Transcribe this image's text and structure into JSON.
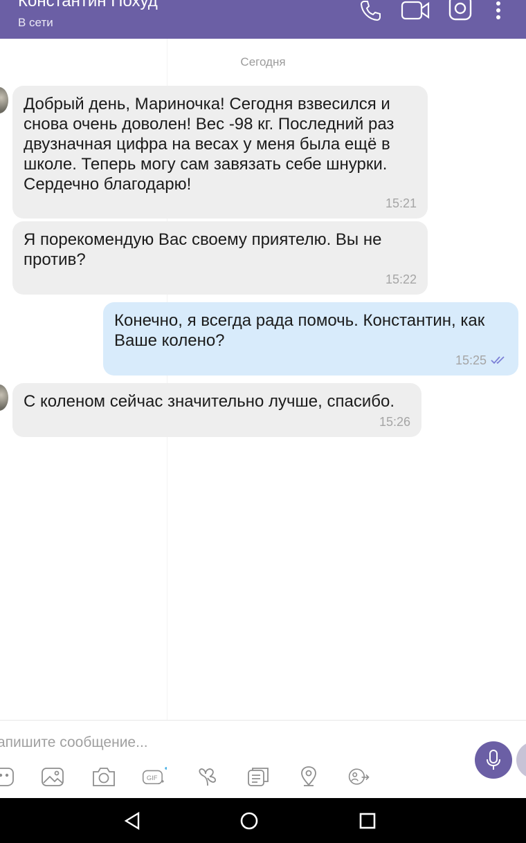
{
  "header": {
    "title": "Константин Похуд",
    "status": "В сети",
    "icons": [
      "phone-icon",
      "video-icon",
      "instagram-icon",
      "more-icon"
    ]
  },
  "chat": {
    "date_separator": "Сегодня",
    "messages": [
      {
        "direction": "incoming",
        "text": "Добрый день, Мариночка! Сегодня взвесился и снова очень доволен! Вес -98 кг. Последний раз двузначная цифра на весах у меня была ещё в школе. Теперь могу сам завязать себе шнурки. Сердечно благодарю!",
        "time": "15:21"
      },
      {
        "direction": "incoming",
        "text": "Я порекомендую Вас своему приятелю. Вы не против?",
        "time": "15:22"
      },
      {
        "direction": "outgoing",
        "text": "Конечно, я всегда рада помочь. Константин, как Ваше колено?",
        "time": "15:25",
        "status": "read"
      },
      {
        "direction": "incoming",
        "text": "С коленом сейчас значительно лучше, спасибо.",
        "time": "15:26"
      }
    ]
  },
  "input": {
    "placeholder": "апишите сообщение...",
    "tools": [
      "sticker-icon",
      "gallery-icon",
      "camera-icon",
      "gif-icon",
      "doodle-icon",
      "file-icon",
      "location-icon",
      "share-icon"
    ]
  },
  "colors": {
    "header": "#6b5fa5",
    "incoming_bubble": "#eeeeee",
    "outgoing_bubble": "#d8ebfb",
    "read_check": "#7b7fd6"
  }
}
